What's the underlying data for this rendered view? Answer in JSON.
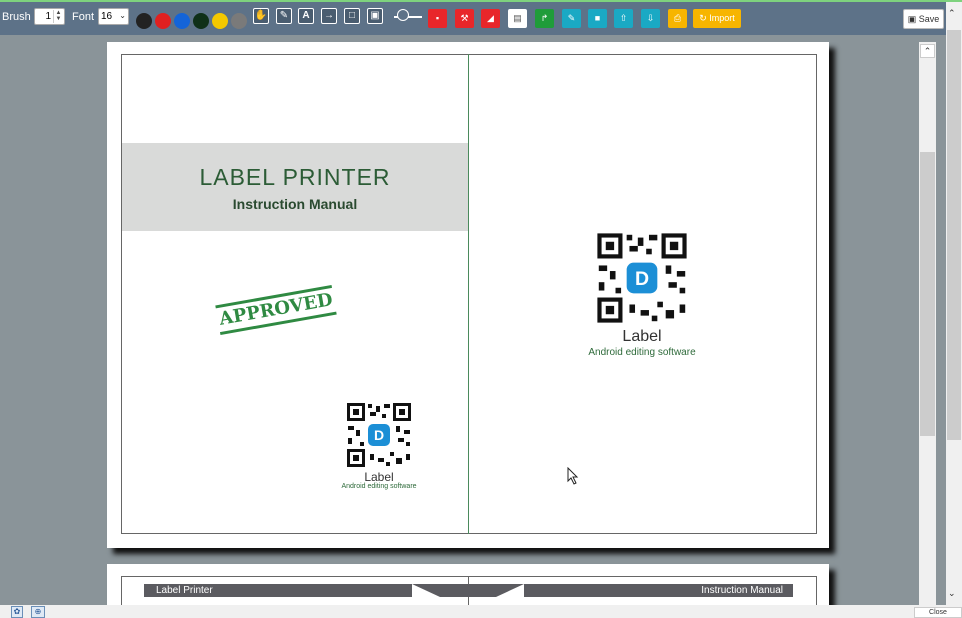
{
  "toolbar": {
    "brush_label": "Brush",
    "brush_value": "1",
    "font_label": "Font",
    "font_value": "16",
    "colors": [
      "#222222",
      "#e02020",
      "#1464d8",
      "#0f3018",
      "#f4c800",
      "#7a7a7a"
    ],
    "tools": [
      "hand-icon",
      "pencil-icon",
      "text-icon",
      "arrow-icon",
      "rectangle-icon",
      "image-icon"
    ],
    "actions": [
      {
        "name": "delete-icon",
        "color": "#e8262a",
        "glyph": "🗑"
      },
      {
        "name": "wrench-icon",
        "color": "#e8262a",
        "glyph": "✎"
      },
      {
        "name": "eraser-icon",
        "color": "#e8262a",
        "glyph": "◢"
      },
      {
        "name": "document-icon",
        "color": "#ffffff",
        "glyph": "▤"
      },
      {
        "name": "redo-icon",
        "color": "#1f9c3a",
        "glyph": "↱"
      },
      {
        "name": "edit-icon",
        "color": "#1aa9c4",
        "glyph": "✎"
      },
      {
        "name": "note-icon",
        "color": "#1aa9c4",
        "glyph": "■"
      },
      {
        "name": "upload-icon",
        "color": "#1aa9c4",
        "glyph": "⇧"
      },
      {
        "name": "download-icon",
        "color": "#1aa9c4",
        "glyph": "⇩"
      },
      {
        "name": "print-icon",
        "color": "#f7b500",
        "glyph": "⎙"
      }
    ],
    "import_label": "Import",
    "save_label": "Save"
  },
  "page1": {
    "title": "LABEL PRINTER",
    "subtitle": "Instruction Manual",
    "stamp": "APPROVED",
    "qr_label_small": "Label",
    "qr_sub_small": "Android editing software",
    "qr_label_large": "Label",
    "qr_sub_large": "Android editing software"
  },
  "page2": {
    "header_left": "Label Printer",
    "header_right": "Instruction Manual"
  },
  "status": {
    "close_label": "Close"
  }
}
